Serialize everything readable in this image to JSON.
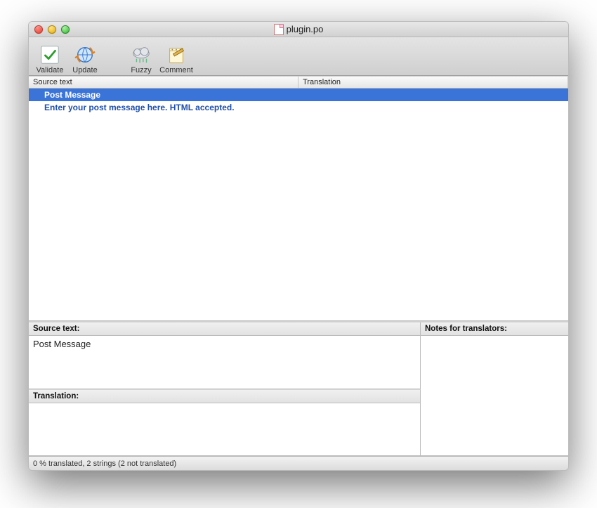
{
  "window": {
    "title": "plugin.po"
  },
  "toolbar": {
    "validate": "Validate",
    "update": "Update",
    "fuzzy": "Fuzzy",
    "comment": "Comment"
  },
  "columns": {
    "source": "Source text",
    "translation": "Translation"
  },
  "rows": [
    {
      "source": "Post Message",
      "translation": "",
      "selected": true
    },
    {
      "source": "Enter your post message here. HTML accepted.",
      "translation": "",
      "selected": false
    }
  ],
  "editor": {
    "source_label": "Source text:",
    "source_value": "Post Message",
    "translation_label": "Translation:",
    "translation_value": "",
    "notes_label": "Notes for translators:",
    "notes_value": ""
  },
  "status": "0 % translated, 2 strings (2 not translated)"
}
